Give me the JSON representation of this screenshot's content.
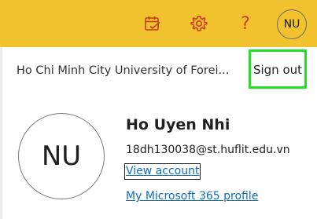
{
  "header": {
    "icons": [
      {
        "name": "calendar-check-icon",
        "tooltip": ""
      },
      {
        "name": "gear-icon"
      },
      {
        "name": "help-icon",
        "glyph": "?"
      }
    ],
    "avatar_initials": "NU",
    "background_color": "#f2c12e",
    "icon_color": "#c43e1c"
  },
  "account_panel": {
    "organization": "Ho Chi Minh City University of Forei...",
    "sign_out_label": "Sign out",
    "highlight_color": "#22e022",
    "avatar_initials": "NU",
    "user_name": "Ho Uyen Nhi",
    "user_email": "18dh130038@st.huflit.edu.vn",
    "view_account_label": "View account",
    "profile_link_label": "My Microsoft 365 profile",
    "link_color": "#0f6cbd"
  }
}
